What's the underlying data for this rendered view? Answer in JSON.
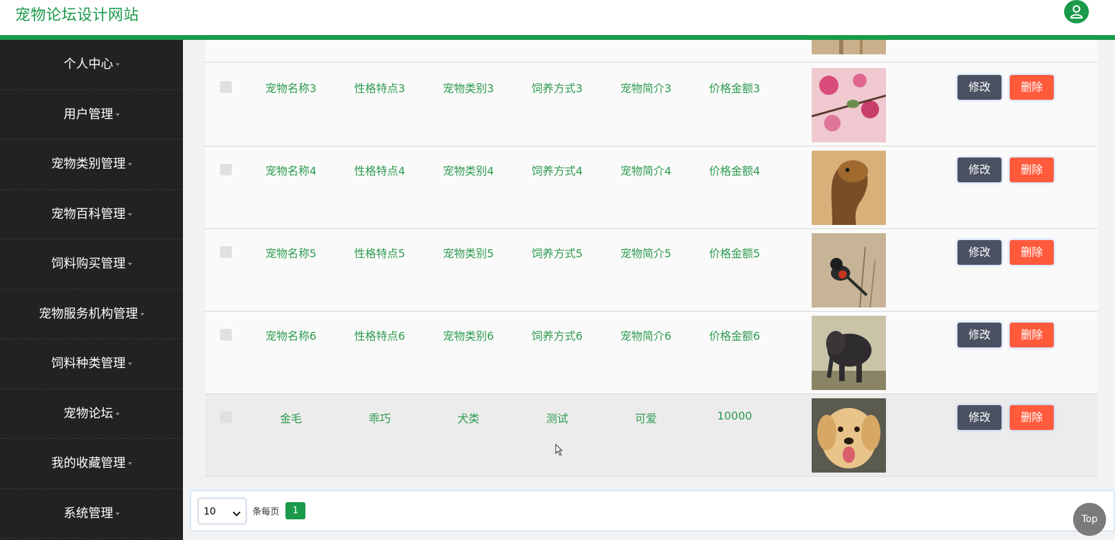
{
  "header": {
    "title": "宠物论坛设计网站"
  },
  "sidebar": {
    "items": [
      {
        "label": "个人中心"
      },
      {
        "label": "用户管理"
      },
      {
        "label": "宠物类别管理"
      },
      {
        "label": "宠物百科管理"
      },
      {
        "label": "饲料购买管理"
      },
      {
        "label": "宠物服务机构管理"
      },
      {
        "label": "饲料种类管理"
      },
      {
        "label": "宠物论坛"
      },
      {
        "label": "我的收藏管理"
      },
      {
        "label": "系统管理"
      }
    ]
  },
  "table": {
    "rows": [
      {
        "name": "宠物名称3",
        "trait": "性格特点3",
        "category": "宠物类别3",
        "feeding": "饲养方式3",
        "intro": "宠物简介3",
        "price": "价格金额3",
        "image": "flower-bird-photo"
      },
      {
        "name": "宠物名称4",
        "trait": "性格特点4",
        "category": "宠物类别4",
        "feeding": "饲养方式4",
        "intro": "宠物简介4",
        "price": "价格金额4",
        "image": "cobra-photo"
      },
      {
        "name": "宠物名称5",
        "trait": "性格特点5",
        "category": "宠物类别5",
        "feeding": "饲养方式5",
        "intro": "宠物简介5",
        "price": "价格金额5",
        "image": "small-bird-photo"
      },
      {
        "name": "宠物名称6",
        "trait": "性格特点6",
        "category": "宠物类别6",
        "feeding": "饲养方式6",
        "intro": "宠物简介6",
        "price": "价格金额6",
        "image": "elephant-photo"
      },
      {
        "name": "金毛",
        "trait": "乖巧",
        "category": "犬类",
        "feeding": "测试",
        "intro": "可爱",
        "price": "10000",
        "image": "golden-retriever-photo"
      }
    ],
    "edit_label": "修改",
    "delete_label": "删除"
  },
  "pagination": {
    "page_size": "10",
    "per_page_label": "条每页",
    "current_page": "1"
  },
  "top_button": "Top",
  "colors": {
    "accent": "#1a9a4a",
    "delete": "#ff5a3c",
    "edit": "#4a5162",
    "sidebar": "#222222"
  }
}
